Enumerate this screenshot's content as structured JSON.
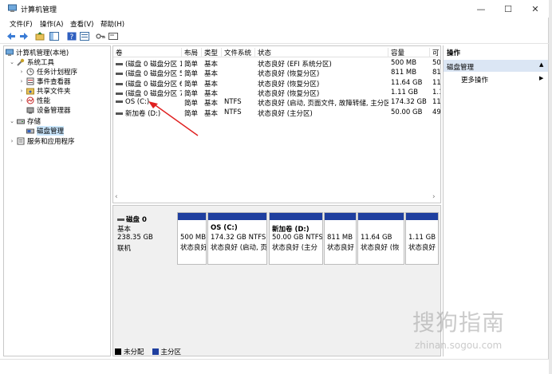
{
  "window": {
    "title": "计算机管理",
    "min": "—",
    "max": "☐",
    "close": "✕"
  },
  "menu": [
    "文件(F)",
    "操作(A)",
    "查看(V)",
    "帮助(H)"
  ],
  "tree": {
    "root": "计算机管理(本地)",
    "system_tools": "系统工具",
    "task_scheduler": "任务计划程序",
    "event_viewer": "事件查看器",
    "shared_folders": "共享文件夹",
    "performance": "性能",
    "device_manager": "设备管理器",
    "storage": "存储",
    "disk_management": "磁盘管理",
    "services": "服务和应用程序"
  },
  "volumes": {
    "columns": [
      "卷",
      "布局",
      "类型",
      "文件系统",
      "状态",
      "容量",
      "可"
    ],
    "rows": [
      {
        "name": "(磁盘 0 磁盘分区 1)",
        "layout": "简单",
        "type": "基本",
        "fs": "",
        "status": "状态良好 (EFI 系统分区)",
        "capacity": "500 MB",
        "free": "50"
      },
      {
        "name": "(磁盘 0 磁盘分区 5)",
        "layout": "简单",
        "type": "基本",
        "fs": "",
        "status": "状态良好 (恢复分区)",
        "capacity": "811 MB",
        "free": "81"
      },
      {
        "name": "(磁盘 0 磁盘分区 6)",
        "layout": "简单",
        "type": "基本",
        "fs": "",
        "status": "状态良好 (恢复分区)",
        "capacity": "11.64 GB",
        "free": "11"
      },
      {
        "name": "(磁盘 0 磁盘分区 7)",
        "layout": "简单",
        "type": "基本",
        "fs": "",
        "status": "状态良好 (恢复分区)",
        "capacity": "1.11 GB",
        "free": "1.1"
      },
      {
        "name": "OS (C:)",
        "layout": "简单",
        "type": "基本",
        "fs": "NTFS",
        "status": "状态良好 (启动, 页面文件, 故障转储, 主分区)",
        "capacity": "174.32 GB",
        "free": "11"
      },
      {
        "name": "新加卷 (D:)",
        "layout": "简单",
        "type": "基本",
        "fs": "NTFS",
        "status": "状态良好 (主分区)",
        "capacity": "50.00 GB",
        "free": "49"
      }
    ]
  },
  "disk": {
    "name": "磁盘 0",
    "kind": "基本",
    "size": "238.35 GB",
    "state": "联机",
    "partitions": [
      {
        "line1": "",
        "line2": "500 MB",
        "line3": "状态良好"
      },
      {
        "line1": "OS  (C:)",
        "line2": "174.32 GB NTFS",
        "line3": "状态良好 (启动, 页"
      },
      {
        "line1": "新加卷  (D:)",
        "line2": "50.00 GB NTFS",
        "line3": "状态良好 (主分"
      },
      {
        "line1": "",
        "line2": "811 MB",
        "line3": "状态良好"
      },
      {
        "line1": "",
        "line2": "11.64 GB",
        "line3": "状态良好 (恢"
      },
      {
        "line1": "",
        "line2": "1.11 GB",
        "line3": "状态良好"
      }
    ]
  },
  "legend": {
    "unallocated": "未分配",
    "primary": "主分区"
  },
  "actions": {
    "header": "操作",
    "section": "磁盘管理",
    "more": "更多操作"
  },
  "watermark": {
    "brand": "搜狗指南",
    "url": "zhinan.sogou.com"
  },
  "colors": {
    "partition_bar": "#1f3f9f",
    "selection": "#cce8ff",
    "arrow": "#e02020"
  }
}
